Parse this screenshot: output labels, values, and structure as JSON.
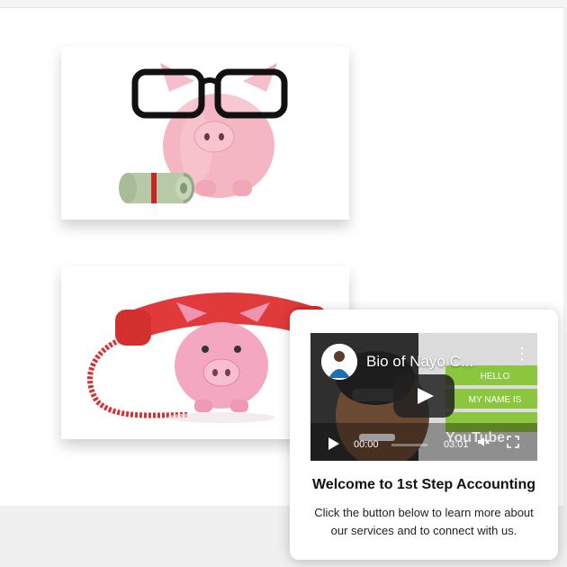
{
  "video": {
    "title": "Bio of Nayo C...",
    "current_time": "00:00",
    "duration": "03:01",
    "platform_logo": "YouTube",
    "more_icon": "kebab-icon"
  },
  "popup": {
    "title": "Welcome to 1st Step Accounting",
    "body": "Click the button below to learn more about our services and to connect with us."
  },
  "images": [
    {
      "name": "piggy-bank-glasses-image"
    },
    {
      "name": "piggy-bank-phone-image"
    }
  ],
  "colors": {
    "page_bg": "#ffffff",
    "footer_band": "#f0f0f0",
    "piggy_pink": "#f4b6c2",
    "phone_red": "#e03a3a",
    "name_tag_green": "#8cc63f"
  }
}
